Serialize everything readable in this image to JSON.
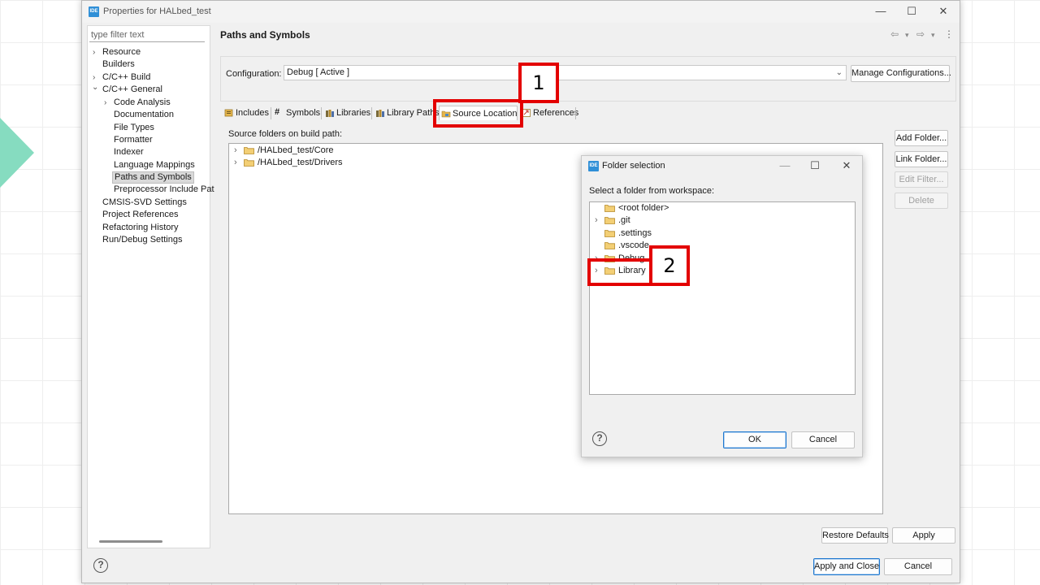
{
  "window": {
    "title": "Properties for HALbed_test",
    "badge": "IDE",
    "minimize_glyph": "—",
    "maximize_glyph": "☐",
    "close_glyph": "✕"
  },
  "nav": {
    "filter_placeholder": "type filter text",
    "items": [
      {
        "label": "Resource",
        "expander": "›"
      },
      {
        "label": "Builders"
      },
      {
        "label": "C/C++ Build",
        "expander": "›"
      },
      {
        "label": "C/C++ General",
        "expander": "⌄"
      },
      {
        "label": "Code Analysis",
        "expander": "›"
      },
      {
        "label": "Documentation"
      },
      {
        "label": "File Types"
      },
      {
        "label": "Formatter"
      },
      {
        "label": "Indexer"
      },
      {
        "label": "Language Mappings"
      },
      {
        "label": "Paths and Symbols",
        "selected": true
      },
      {
        "label": "Preprocessor Include Pat"
      },
      {
        "label": "CMSIS-SVD Settings"
      },
      {
        "label": "Project References"
      },
      {
        "label": "Refactoring History"
      },
      {
        "label": "Run/Debug Settings"
      }
    ]
  },
  "panel": {
    "title": "Paths and Symbols",
    "configuration_label": "Configuration:",
    "configuration_value": "Debug  [ Active ]",
    "manage_configurations": "Manage Configurations...",
    "tabs": [
      {
        "label": "Includes",
        "icon": "includes-icon"
      },
      {
        "label": "Symbols",
        "icon": "hash-icon"
      },
      {
        "label": "Libraries",
        "icon": "libraries-icon"
      },
      {
        "label": "Library Paths",
        "icon": "library-paths-icon"
      },
      {
        "label": "Source Location",
        "icon": "source-folder-icon",
        "active": true
      },
      {
        "label": "References",
        "icon": "references-icon"
      }
    ],
    "source_folders_label": "Source folders on build path:",
    "source_folders": [
      "/HALbed_test/Core",
      "/HALbed_test/Drivers"
    ],
    "side_buttons": {
      "add_folder": "Add Folder...",
      "link_folder": "Link Folder...",
      "edit_filter": "Edit Filter...",
      "delete": "Delete"
    },
    "restore_defaults": "Restore Defaults",
    "apply": "Apply",
    "apply_and_close": "Apply and Close",
    "cancel": "Cancel"
  },
  "history": {
    "back": "⇦",
    "back_menu": "▾",
    "forward": "⇨",
    "forward_menu": "▾",
    "more": "⋮"
  },
  "dialog": {
    "title": "Folder selection",
    "badge": "IDE",
    "prompt": "Select a folder from workspace:",
    "folders": [
      {
        "label": "<root folder>",
        "expander": ""
      },
      {
        "label": ".git",
        "expander": "›"
      },
      {
        "label": ".settings",
        "expander": ""
      },
      {
        "label": ".vscode",
        "expander": ""
      },
      {
        "label": "Debug",
        "expander": "›"
      },
      {
        "label": "Library",
        "expander": "›"
      }
    ],
    "ok": "OK",
    "cancel": "Cancel",
    "minimize_glyph": "—",
    "maximize_glyph": "☐",
    "close_glyph": "✕"
  },
  "help_glyph": "?",
  "callouts": {
    "first": "1",
    "second": "2"
  },
  "colors": {
    "callout": "#e30000",
    "folder": "#e6b64c",
    "ide_badge": "#2f8fd7",
    "slide_accent": "#86dcc0"
  }
}
